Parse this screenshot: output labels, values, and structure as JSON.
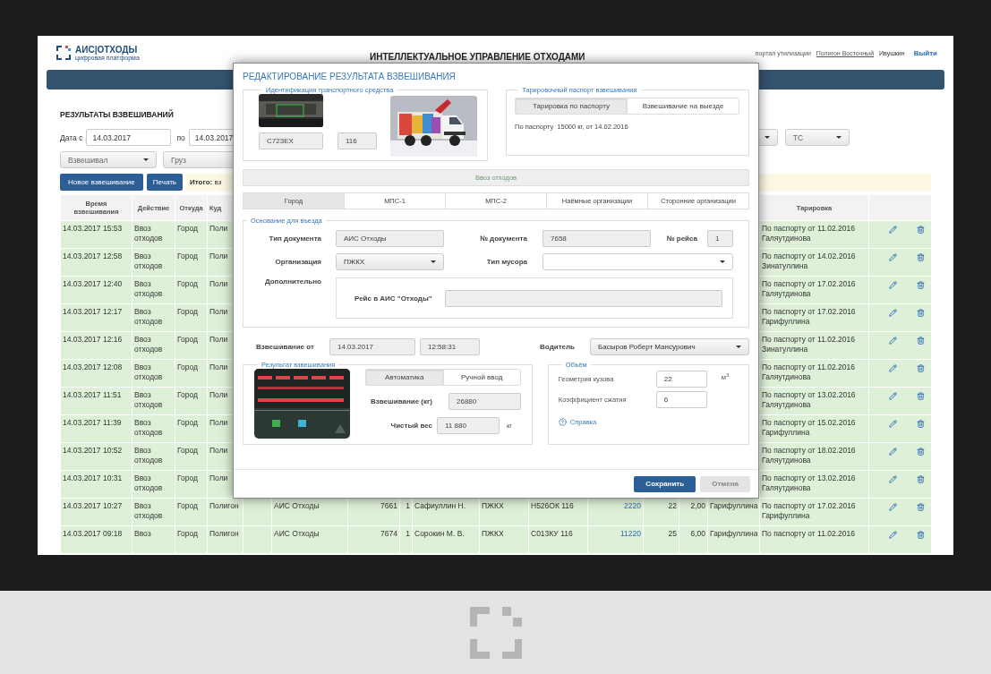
{
  "header": {
    "logo": "АИС|ОТХОДЫ",
    "tagline": "цифровая платформа",
    "title": "ИНТЕЛЛЕКТУАЛЬНОЕ УПРАВЛЕНИЕ ОТХОДАМИ",
    "portal_label": "портал утилизации",
    "portal_link": "Полигон Восточный",
    "user": "Ивушкин",
    "logout": "Выйти"
  },
  "page_title": "РЕЗУЛЬТАТЫ ВЗВЕШИВАНИЙ",
  "filters": {
    "date_from_label": "Дата с",
    "date_from": "14.03.2017",
    "date_to_label": "по",
    "date_to": "14.03.2017",
    "vehicle": "ТС",
    "weigher": "Взвешивал",
    "cargo": "Груз"
  },
  "actions": {
    "new": "Новое взвешивание",
    "print": "Печать",
    "summary": "**Итого:** вз"
  },
  "table": {
    "columns": {
      "time": "Время взвешивания",
      "action": "Действие",
      "from": "Откуда",
      "to": "Куд",
      "tariff": "Тарировка"
    },
    "rows": [
      {
        "time": "14.03.2017 15:53",
        "action": "Ввоз\nотходов",
        "from": "Город",
        "to": "Поли",
        "tariff": "По паспорту от 11.02.2016\nГаляутдинова"
      },
      {
        "time": "14.03.2017 12:58",
        "action": "Ввоз\nотходов",
        "from": "Город",
        "to": "Поли",
        "tariff": "По паспорту от 14.02.2016\nЗинатуллина"
      },
      {
        "time": "14.03.2017 12:40",
        "action": "Ввоз\nотходов",
        "from": "Город",
        "to": "Поли",
        "tariff": "По паспорту от 17.02.2016\nГаляутдинова"
      },
      {
        "time": "14.03.2017 12:17",
        "action": "Ввоз\nотходов",
        "from": "Город",
        "to": "Поли",
        "tariff": "По паспорту от 17.02.2016\nГарифуллина"
      },
      {
        "time": "14.03.2017 12:16",
        "action": "Ввоз\nотходов",
        "from": "Город",
        "to": "Поли",
        "tariff": "По паспорту от 11.02.2016\nЗинатуллина"
      },
      {
        "time": "14.03.2017 12:08",
        "action": "Ввоз\nотходов",
        "from": "Город",
        "to": "Поли",
        "tariff": "По паспорту от 11.02.2016\nГаляутдинова"
      },
      {
        "time": "14.03.2017 11:51",
        "action": "Ввоз\nотходов",
        "from": "Город",
        "to": "Поли",
        "tariff": "По паспорту от 13.02.2016\nГаляутдинова"
      },
      {
        "time": "14.03.2017 11:39",
        "action": "Ввоз\nотходов",
        "from": "Город",
        "to": "Поли",
        "tariff": "По паспорту от 15.02.2016\nГарифуллина"
      },
      {
        "time": "14.03.2017 10:52",
        "action": "Ввоз\nотходов",
        "from": "Город",
        "to": "Поли",
        "tariff": "По паспорту от 18.02.2016\nГаляутдинова"
      },
      {
        "time": "14.03.2017 10:31",
        "action": "Ввоз\nотходов",
        "from": "Город",
        "to": "Поли",
        "tariff": "По паспорту от 13.02.2016\nГаляутдинова"
      },
      {
        "time": "14.03.2017 10:27",
        "action": "Ввоз\nотходов",
        "from": "Город",
        "to": "Полигон",
        "doc_type": "АИС Отходы",
        "doc_no": "7661",
        "trip": "1",
        "driver": "Сафиуллин Н.",
        "org": "ПЖКХ",
        "plate": "Н526ОК 116",
        "weight": "2220",
        "volume": "22",
        "ratio": "2,00",
        "operator": "Гарифуллина",
        "tariff": "По паспорту от 17.02.2016\nГарифуллина"
      },
      {
        "time": "14.03.2017 09:18",
        "action": "Ввоз",
        "from": "Город",
        "to": "Полигон",
        "doc_type": "АИС Отходы",
        "doc_no": "7674",
        "trip": "1",
        "driver": "Сорокин М. В.",
        "org": "ПЖКХ",
        "plate": "С013КУ 116",
        "weight": "11220",
        "volume": "25",
        "ratio": "6,00",
        "operator": "Гарифуллина",
        "tariff": "По паспорту от 11.02.2016"
      }
    ]
  },
  "dialog": {
    "title": "РЕДАКТИРОВАНИЕ РЕЗУЛЬТАТА ВЗВЕШИВАНИЯ",
    "vehicle": {
      "legend": "Идентификация транспортного средства",
      "plate": "С723ЕХ",
      "region": "116"
    },
    "tare": {
      "legend": "Тарировочный паспорт взвешивания",
      "modes": [
        {
          "label": "Тарировка по паспорту",
          "selected": true
        },
        {
          "label": "Взвешивание на выезде",
          "selected": false
        }
      ],
      "info": "По паспорту  15000 кг, от 14.02.2016"
    },
    "operation": "Ввоз отходов",
    "tabs": [
      {
        "label": "Город",
        "selected": true
      },
      {
        "label": "МПС-1",
        "selected": false
      },
      {
        "label": "МПС-2",
        "selected": false
      },
      {
        "label": "Наёмные организации",
        "selected": false
      },
      {
        "label": "Сторонние организации",
        "selected": false
      }
    ],
    "basis": {
      "legend": "Основание для въезда",
      "doc_type_label": "Тип документа",
      "doc_type": "АИС Отходы",
      "doc_no_label": "№ документа",
      "doc_no": "7658",
      "trip_label": "№ рейса",
      "trip": "1",
      "org_label": "Организация",
      "org": "ПЖКХ",
      "waste_label": "Тип мусора",
      "extra_label": "Дополнительно",
      "ais_trip_label": "Рейс в АИС \"Отходы\""
    },
    "weighing": {
      "label": "Взвешивание от",
      "date": "14.03.2017",
      "time": "12:58:31",
      "driver_label": "Водитель",
      "driver": "Басыров Роберт Мансурович"
    },
    "result": {
      "legend": "Результат взвешивания",
      "modes": [
        {
          "label": "Автоматика",
          "selected": true
        },
        {
          "label": "Ручной ввод",
          "selected": false
        }
      ],
      "gross_label": "Взвешивание (кг)",
      "gross": "26880",
      "net_label": "Чистый вес",
      "net": "11 880",
      "net_unit": "кг"
    },
    "volume": {
      "legend": "Объём",
      "body_label": "Геометрия кузова",
      "body": "22",
      "body_unit": "м$^{3}$",
      "ratio_label": "Коэффициент сжатия",
      "ratio": "6",
      "help": "Справка"
    },
    "buttons": [
      {
        "label": "Сохранить",
        "kind": "primary"
      },
      {
        "label": "Отмена",
        "kind": "secondary"
      }
    ]
  }
}
